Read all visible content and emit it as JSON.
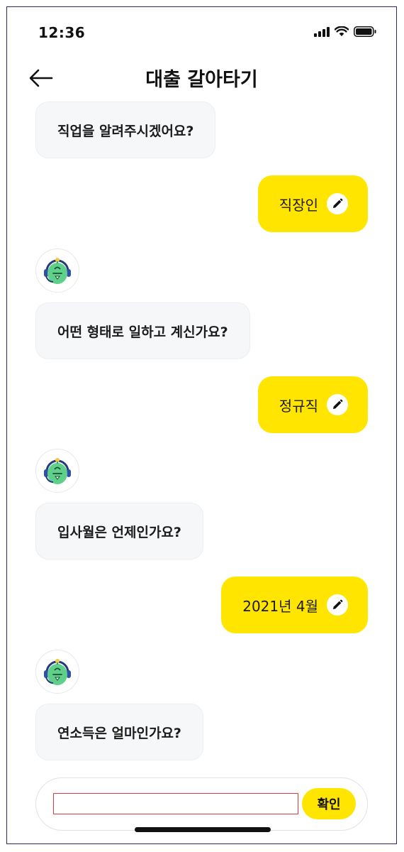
{
  "status_bar": {
    "time": "12:36"
  },
  "header": {
    "title": "대출 갈아타기",
    "back_icon": "arrow-left-icon"
  },
  "chat": {
    "questions": [
      "직업을 알려주시겠어요?",
      "어떤 형태로 일하고 계신가요?",
      "입사월은 언제인가요?",
      "연소득은 얼마인가요?"
    ],
    "answers": [
      "직장인",
      "정규직",
      "2021년 4월"
    ]
  },
  "input": {
    "value": "",
    "placeholder": "",
    "confirm_label": "확인"
  },
  "colors": {
    "accent": "#ffe500",
    "bot_bubble": "#f6f7f9",
    "avatar_green": "#5fd08a",
    "input_border": "#e0383e"
  }
}
